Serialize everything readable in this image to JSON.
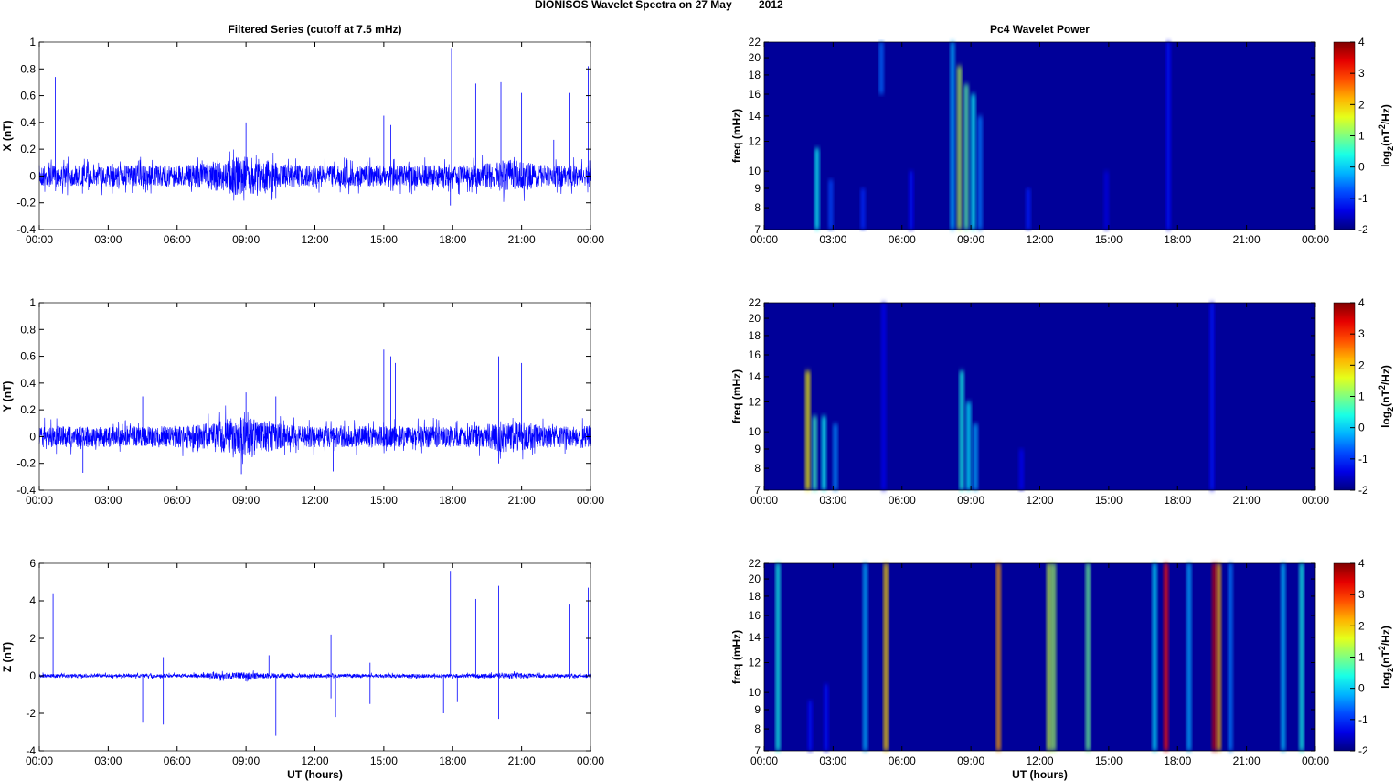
{
  "title": "DIONISOS Wavelet Spectra on 27 May",
  "year": "2012",
  "chart_data": [
    {
      "type": "line",
      "title": "Filtered Series (cutoff at 7.5 mHz)",
      "ylabel": "X (nT)",
      "xlabel": "",
      "ylim": [
        -0.4,
        1
      ],
      "yticks": [
        "1",
        "0.8",
        "0.6",
        "0.4",
        "0.2",
        "0",
        "-0.2",
        "-0.4"
      ],
      "ytick_values": [
        1,
        0.8,
        0.6,
        0.4,
        0.2,
        0,
        -0.2,
        -0.4
      ],
      "xticks": [
        "00:00",
        "03:00",
        "06:00",
        "09:00",
        "12:00",
        "15:00",
        "18:00",
        "21:00",
        "00:00"
      ],
      "noise_amplitude": 0.08,
      "spikes": [
        [
          0.7,
          0.74
        ],
        [
          9,
          0.4
        ],
        [
          15,
          0.45
        ],
        [
          15.3,
          0.38
        ],
        [
          17.95,
          0.95
        ],
        [
          19,
          0.69
        ],
        [
          20.1,
          0.7
        ],
        [
          21,
          0.62
        ],
        [
          22.4,
          0.27
        ],
        [
          23.1,
          0.62
        ],
        [
          23.9,
          0.82
        ],
        [
          8.7,
          -0.3
        ],
        [
          17.9,
          -0.22
        ]
      ]
    },
    {
      "type": "line",
      "title": "",
      "ylabel": "Y (nT)",
      "xlabel": "",
      "ylim": [
        -0.4,
        1
      ],
      "yticks": [
        "1",
        "0.8",
        "0.6",
        "0.4",
        "0.2",
        "0",
        "-0.2",
        "-0.4"
      ],
      "ytick_values": [
        1,
        0.8,
        0.6,
        0.4,
        0.2,
        0,
        -0.2,
        -0.4
      ],
      "xticks": [
        "00:00",
        "03:00",
        "06:00",
        "09:00",
        "12:00",
        "15:00",
        "18:00",
        "21:00",
        "00:00"
      ],
      "noise_amplitude": 0.08,
      "spikes": [
        [
          15,
          0.65
        ],
        [
          15.3,
          0.6
        ],
        [
          15.5,
          0.55
        ],
        [
          20,
          0.6
        ],
        [
          21,
          0.55
        ],
        [
          10.3,
          0.3
        ],
        [
          9,
          0.33
        ],
        [
          4.5,
          0.3
        ],
        [
          1.9,
          -0.27
        ],
        [
          8.8,
          -0.28
        ],
        [
          12.8,
          -0.26
        ],
        [
          20,
          -0.2
        ]
      ]
    },
    {
      "type": "line",
      "title": "",
      "ylabel": "Z (nT)",
      "xlabel": "UT (hours)",
      "ylim": [
        -4,
        6
      ],
      "yticks": [
        "6",
        "4",
        "2",
        "0",
        "-2",
        "-4"
      ],
      "ytick_values": [
        6,
        4,
        2,
        0,
        -2,
        -4
      ],
      "xticks": [
        "00:00",
        "03:00",
        "06:00",
        "09:00",
        "12:00",
        "15:00",
        "18:00",
        "21:00",
        "00:00"
      ],
      "noise_amplitude": 0.1,
      "spikes": [
        [
          0.6,
          4.4
        ],
        [
          5.4,
          1
        ],
        [
          10,
          1.1
        ],
        [
          12.7,
          2.2
        ],
        [
          14.4,
          0.7
        ],
        [
          17.9,
          5.6
        ],
        [
          19,
          4.1
        ],
        [
          20,
          4.8
        ],
        [
          23.1,
          3.8
        ],
        [
          23.9,
          4.7
        ],
        [
          4.5,
          -2.5
        ],
        [
          5.4,
          -2.6
        ],
        [
          10.3,
          -3.2
        ],
        [
          12.7,
          -1.2
        ],
        [
          12.9,
          -2.2
        ],
        [
          14.4,
          -1.5
        ],
        [
          17.6,
          -2
        ],
        [
          18.2,
          -1.4
        ],
        [
          20,
          -2.3
        ]
      ]
    },
    {
      "type": "heatmap",
      "title": "Pc4 Wavelet Power",
      "ylabel": "freq (mHz)",
      "xlabel": "",
      "colorbar_label": "log2(nT^2/Hz)",
      "clim": [
        -2,
        4
      ],
      "yticks": [
        "22",
        "20",
        "18",
        "16",
        "14",
        "12",
        "10",
        "9",
        "8",
        "7"
      ],
      "ytick_values": [
        22,
        20,
        18,
        16,
        14,
        12,
        10,
        9,
        8,
        7
      ],
      "cticks": [
        "4",
        "3",
        "2",
        "1",
        "0",
        "-1",
        "-2"
      ],
      "xticks": [
        "00:00",
        "03:00",
        "06:00",
        "09:00",
        "12:00",
        "15:00",
        "18:00",
        "21:00",
        "00:00"
      ],
      "features": [
        [
          2.3,
          7,
          11.5,
          0.3
        ],
        [
          2.9,
          7,
          9.5,
          -0.8
        ],
        [
          4.3,
          7,
          9,
          -1
        ],
        [
          5.1,
          16,
          22,
          -0.6
        ],
        [
          6.4,
          7,
          10,
          -1.2
        ],
        [
          8.2,
          7,
          22,
          -0.2
        ],
        [
          8.5,
          7,
          19,
          1.3
        ],
        [
          8.8,
          7,
          17,
          0.8
        ],
        [
          9.1,
          7,
          16,
          0.3
        ],
        [
          9.4,
          7,
          14,
          -0.5
        ],
        [
          11.5,
          7,
          9,
          -1.1
        ],
        [
          14.9,
          7,
          10,
          -1.4
        ],
        [
          17.6,
          7,
          22,
          -1.2
        ]
      ]
    },
    {
      "type": "heatmap",
      "title": "",
      "ylabel": "freq (mHz)",
      "xlabel": "",
      "colorbar_label": "log2(nT^2/Hz)",
      "clim": [
        -2,
        4
      ],
      "yticks": [
        "22",
        "20",
        "18",
        "16",
        "14",
        "12",
        "10",
        "9",
        "8",
        "7"
      ],
      "ytick_values": [
        22,
        20,
        18,
        16,
        14,
        12,
        10,
        9,
        8,
        7
      ],
      "cticks": [
        "4",
        "3",
        "2",
        "1",
        "0",
        "-1",
        "-2"
      ],
      "xticks": [
        "00:00",
        "03:00",
        "06:00",
        "09:00",
        "12:00",
        "15:00",
        "18:00",
        "21:00",
        "00:00"
      ],
      "features": [
        [
          1.9,
          7,
          14.5,
          1.8
        ],
        [
          2.2,
          7,
          11,
          0.6
        ],
        [
          2.6,
          7,
          11,
          0.3
        ],
        [
          3.1,
          7,
          10.5,
          -0.4
        ],
        [
          5.2,
          7,
          22,
          -1.3
        ],
        [
          8.6,
          7,
          14.5,
          0.4
        ],
        [
          8.9,
          7,
          12,
          0.2
        ],
        [
          9.2,
          7,
          10.5,
          -0.2
        ],
        [
          11.2,
          7,
          9,
          -1.3
        ],
        [
          19.5,
          7,
          22,
          -1.2
        ]
      ]
    },
    {
      "type": "heatmap",
      "title": "",
      "ylabel": "freq (mHz)",
      "xlabel": "UT (hours)",
      "colorbar_label": "log2(nT^2/Hz)",
      "clim": [
        -2,
        4
      ],
      "yticks": [
        "22",
        "20",
        "18",
        "16",
        "14",
        "12",
        "10",
        "9",
        "8",
        "7"
      ],
      "ytick_values": [
        22,
        20,
        18,
        16,
        14,
        12,
        10,
        9,
        8,
        7
      ],
      "cticks": [
        "4",
        "3",
        "2",
        "1",
        "0",
        "-1",
        "-2"
      ],
      "xticks": [
        "00:00",
        "03:00",
        "06:00",
        "09:00",
        "12:00",
        "15:00",
        "18:00",
        "21:00",
        "00:00"
      ],
      "features": [
        [
          0.6,
          7,
          22,
          0.4
        ],
        [
          2.0,
          7,
          9.5,
          -1.2
        ],
        [
          2.7,
          7,
          10.5,
          -1.2
        ],
        [
          4.4,
          7,
          22,
          -0.2
        ],
        [
          5.3,
          7,
          22,
          2
        ],
        [
          10.2,
          7,
          22,
          2.3
        ],
        [
          12.4,
          7,
          22,
          1.4
        ],
        [
          12.6,
          7,
          22,
          1.2
        ],
        [
          14.1,
          7,
          22,
          0.9
        ],
        [
          17.0,
          7,
          22,
          0.1
        ],
        [
          17.5,
          7,
          22,
          3.2
        ],
        [
          18.5,
          7,
          22,
          -0.2
        ],
        [
          19.6,
          7,
          22,
          3.6
        ],
        [
          19.8,
          7,
          22,
          2.2
        ],
        [
          20.3,
          7,
          22,
          -0.5
        ],
        [
          22.6,
          7,
          22,
          -0.1
        ],
        [
          23.4,
          7,
          22,
          0.4
        ]
      ]
    }
  ]
}
